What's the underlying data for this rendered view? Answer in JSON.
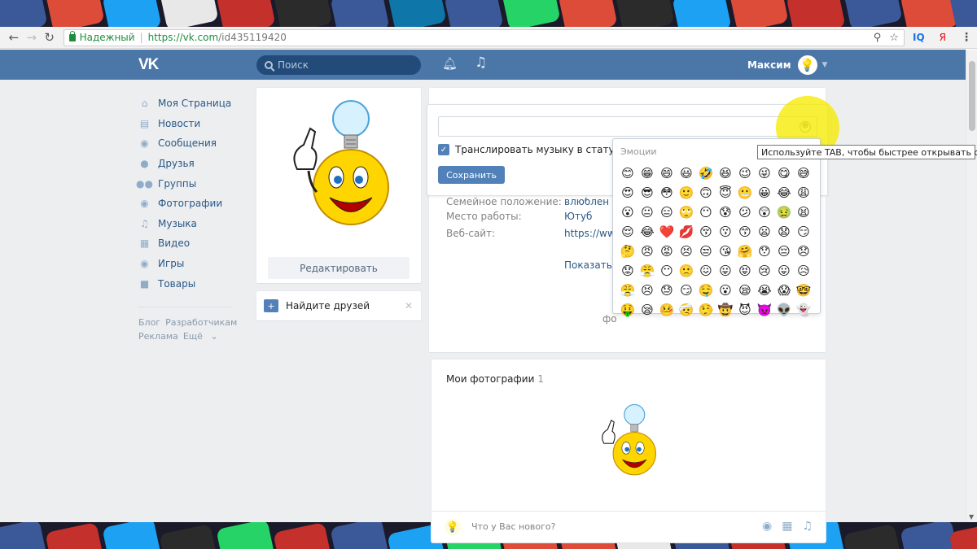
{
  "browser": {
    "secure_label": "Надежный",
    "url_host": "https://vk.com",
    "url_path": "/id435119420",
    "extensions": [
      "IQ",
      "Я"
    ],
    "back_icon": "back-arrow-icon",
    "forward_icon": "forward-arrow-icon",
    "reload_icon": "reload-icon"
  },
  "header": {
    "logo": "VK",
    "search_placeholder": "Поиск",
    "user_name": "Максим",
    "bell_icon": "bell-icon",
    "music_icon": "music-note-icon",
    "accent_color": "#4a76a8"
  },
  "sidebar": {
    "items": [
      {
        "label": "Моя Страница",
        "icon": "home-icon"
      },
      {
        "label": "Новости",
        "icon": "news-icon"
      },
      {
        "label": "Сообщения",
        "icon": "messages-icon"
      },
      {
        "label": "Друзья",
        "icon": "user-icon"
      },
      {
        "label": "Группы",
        "icon": "groups-icon"
      },
      {
        "label": "Фотографии",
        "icon": "camera-icon"
      },
      {
        "label": "Музыка",
        "icon": "music-icon"
      },
      {
        "label": "Видео",
        "icon": "video-icon"
      },
      {
        "label": "Игры",
        "icon": "gamepad-icon"
      },
      {
        "label": "Товары",
        "icon": "bag-icon"
      }
    ],
    "footer": {
      "blog": "Блог",
      "developers": "Разработчикам",
      "ads": "Реклама",
      "more": "Ещё"
    }
  },
  "avatar_card": {
    "edit_label": "Редактировать"
  },
  "friends_card": {
    "label": "Найдите друзей"
  },
  "status_editor": {
    "input_value": "",
    "broadcast_label": "Транслировать музыку в статус",
    "broadcast_checked": true,
    "save_label": "Сохранить"
  },
  "profile_info": {
    "rows": [
      {
        "key": "Семейное положение:",
        "value": "влюблен"
      },
      {
        "key": "Место работы:",
        "value": "Ютуб"
      },
      {
        "key": "Веб-сайт:",
        "value": "https://www"
      }
    ],
    "show_more": "Показать п",
    "tab_cut": "фо"
  },
  "emoji_panel": {
    "header": "Эмоции",
    "emojis": [
      "😊",
      "😁",
      "😄",
      "😃",
      "🤣",
      "😆",
      "😉",
      "😜",
      "😋",
      "😅",
      "😍",
      "😎",
      "😳",
      "🙂",
      "🙃",
      "😇",
      "😬",
      "😀",
      "😂",
      "😩",
      "😮",
      "😐",
      "😑",
      "🙄",
      "😶",
      "😰",
      "😕",
      "😲",
      "🤢",
      "😫",
      "😌",
      "😂",
      "❤️",
      "💋",
      "😚",
      "😗",
      "😙",
      "😦",
      "😧",
      "😏",
      "🤔",
      "😠",
      "😡",
      "😣",
      "😒",
      "😘",
      "🤗",
      "😯",
      "😔",
      "😞",
      "😟",
      "😤",
      "😶",
      "🙁",
      "😖",
      "😛",
      "😝",
      "😢",
      "😛",
      "😥",
      "😤",
      "😣",
      "😓",
      "😏",
      "🤤",
      "😮",
      "😪",
      "😭",
      "😱",
      "🤓",
      "🤑",
      "😪",
      "🤒",
      "🤕",
      "🤥",
      "🤠",
      "😈",
      "👿",
      "👽",
      "👻"
    ]
  },
  "tooltip": {
    "text": "Используйте TAB, чтобы быстрее открывать смайлы"
  },
  "photos": {
    "title": "Мои фотографии",
    "count": "1"
  },
  "post": {
    "placeholder": "Что у Вас нового?"
  }
}
